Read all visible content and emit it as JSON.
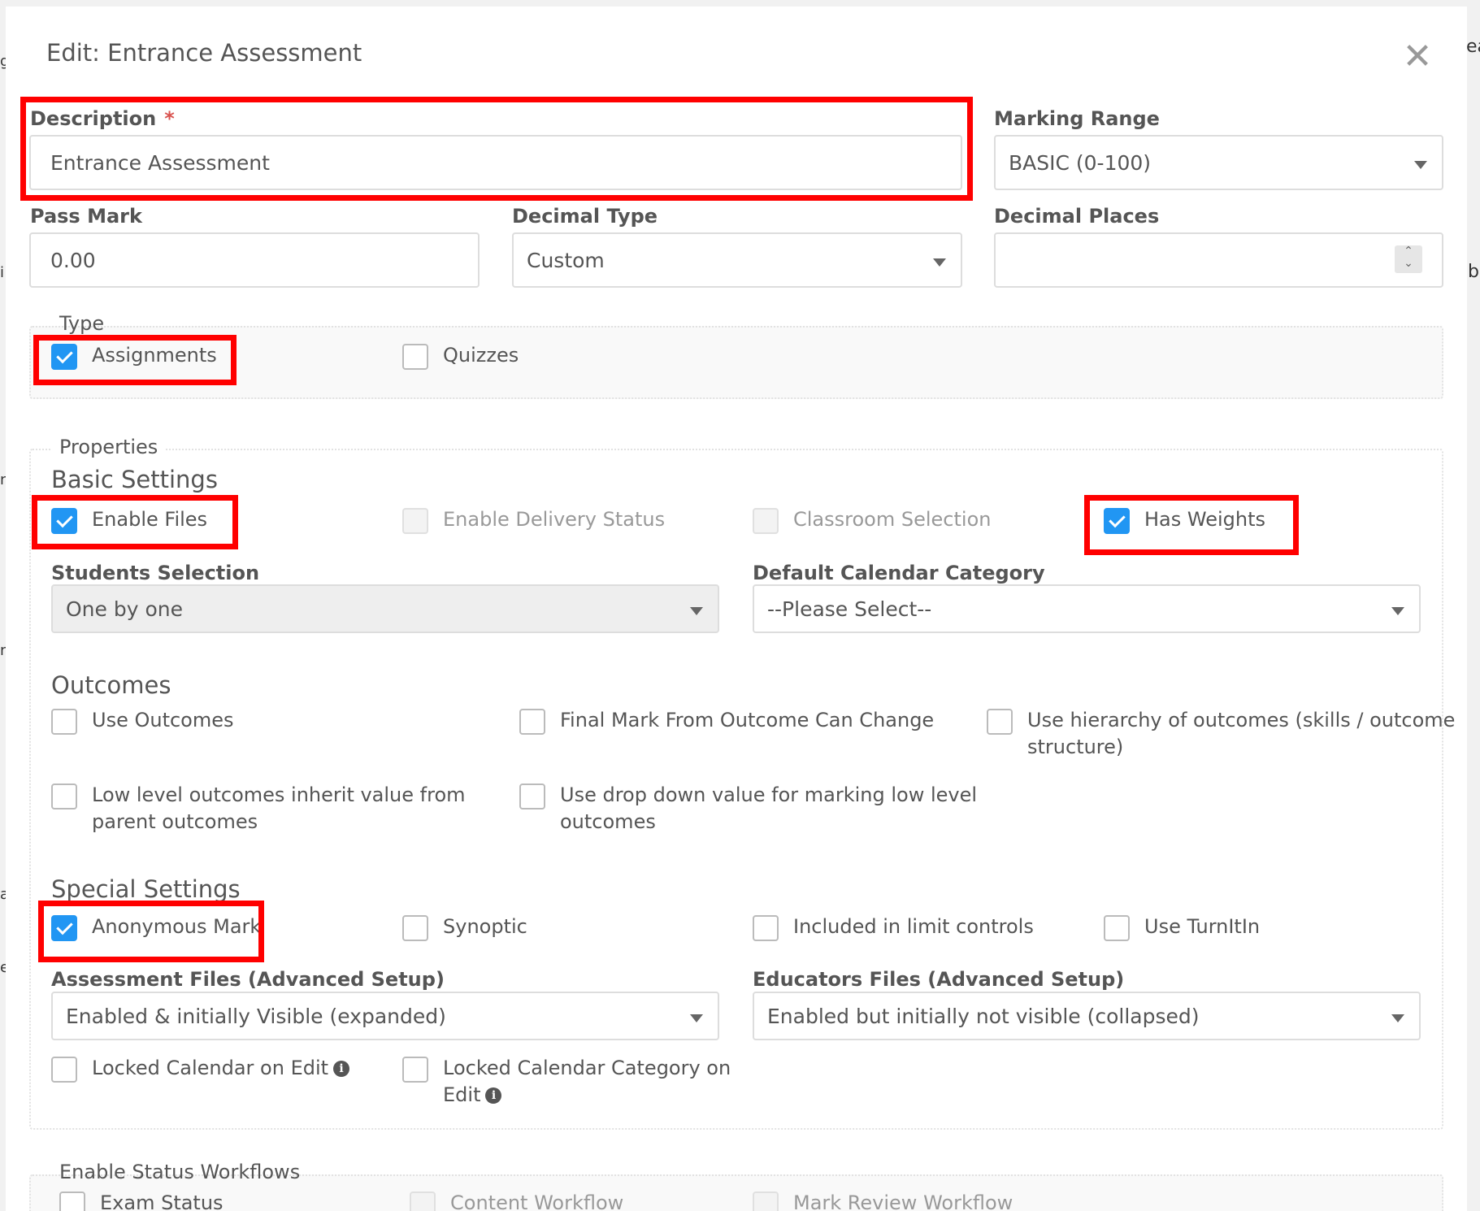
{
  "modal": {
    "title": "Edit: Entrance Assessment",
    "close_glyph": "✕"
  },
  "background": {
    "right_texts": [
      "ea",
      "b"
    ],
    "left_letters": [
      "g",
      "i",
      "n",
      "n",
      "a",
      "e"
    ]
  },
  "fields": {
    "description": {
      "label": "Description",
      "required_mark": "*",
      "value": "Entrance Assessment"
    },
    "marking_range": {
      "label": "Marking Range",
      "value": "BASIC (0-100)"
    },
    "pass_mark": {
      "label": "Pass Mark",
      "value": "0.00"
    },
    "decimal_type": {
      "label": "Decimal Type",
      "value": "Custom"
    },
    "decimal_places": {
      "label": "Decimal Places",
      "value": ""
    }
  },
  "type_group": {
    "legend": "Type",
    "assignments": {
      "label": "Assignments",
      "checked": true
    },
    "quizzes": {
      "label": "Quizzes",
      "checked": false
    }
  },
  "properties": {
    "legend": "Properties",
    "basic": {
      "title": "Basic Settings",
      "enable_files": "Enable Files",
      "enable_delivery_status": "Enable Delivery Status",
      "classroom_selection": "Classroom Selection",
      "has_weights": "Has Weights",
      "students_selection": {
        "label": "Students Selection",
        "value": "One by one"
      },
      "default_calendar_category": {
        "label": "Default Calendar Category",
        "value": "--Please Select--"
      }
    },
    "outcomes": {
      "title": "Outcomes",
      "use_outcomes": "Use Outcomes",
      "final_mark": "Final Mark From Outcome Can Change",
      "hierarchy_line1": "Use hierarchy of outcomes (skills / outcome",
      "hierarchy_line2": "structure)",
      "low_level_line1": "Low level outcomes inherit value from",
      "low_level_line2": "parent outcomes",
      "dropdown_line1": "Use drop down value for marking low level",
      "dropdown_line2": "outcomes"
    },
    "special": {
      "title": "Special Settings",
      "anonymous_mark": "Anonymous Mark",
      "synoptic": "Synoptic",
      "limit_controls": "Included in limit controls",
      "turnitin": "Use TurnItIn",
      "assessment_files": {
        "label": "Assessment Files (Advanced Setup)",
        "value": "Enabled & initially Visible (expanded)"
      },
      "educators_files": {
        "label": "Educators Files (Advanced Setup)",
        "value": "Enabled but initially not visible (collapsed)"
      },
      "locked_calendar": "Locked Calendar on Edit",
      "locked_category_line1": "Locked Calendar Category on",
      "locked_category_line2": "Edit",
      "info_glyph": "i"
    }
  },
  "workflows": {
    "legend": "Enable Status Workflows",
    "exam_status": "Exam Status",
    "content_workflow": "Content Workflow",
    "mark_review_workflow": "Mark Review Workflow"
  },
  "colors": {
    "highlight": "#ff0000",
    "checkbox_checked": "#2196f3",
    "required": "#d9534f"
  }
}
